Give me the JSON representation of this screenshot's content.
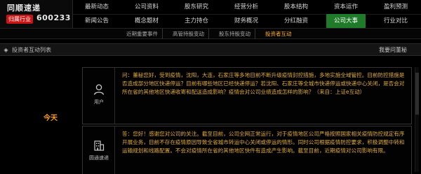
{
  "brand": {
    "title": "同顺速递",
    "badge": "归属行业",
    "stock_code": "600233"
  },
  "nav": {
    "row1": [
      "最新动态",
      "公司资料",
      "股东研究",
      "经营分析",
      "股本结构",
      "资本运作",
      "盈利预测"
    ],
    "row2": [
      "新闻公告",
      "概念题材",
      "主力持仓",
      "财务概况",
      "分红融资",
      "公司大事",
      "行业对比"
    ],
    "active": "公司大事"
  },
  "subnav": {
    "items": [
      "近期重要事件",
      "高管持股变动",
      "股东持股变动",
      "投资者互动"
    ],
    "active": "投资者互动"
  },
  "section": {
    "title": "投资者互动列表",
    "ask_button": "我要问董秘"
  },
  "date_label": "今天",
  "question": {
    "avatar_label": "用户",
    "prefix": "问：",
    "text": "董秘您好，受到疫情，沈阳，大连，石家庄等多地目前不断升级疫情封控措施，多地实施全域管控。目前防控措施是否造成部分地区快递停运？目前有哪些地区已经快递停运？若沈阳、石家庄等全城市快递停运或快递中心关闭，是否会对所在省的其他地区快递收寄和配送造成影响？疫情会对公司业绩造成怎样的影响？（来自：上证e互动）"
  },
  "answer": {
    "avatar_label": "圆通速递",
    "prefix": "答：",
    "text": "您好！感谢您对公司的关注。截至目前，公司全网正常运行，对于疫情地区公司严格按照国家相关疫情防控规定有序开展业务，目前不存在疫情原因导致全省城市转运中心关闭或停运的情形。同时公司根据疫情防控要求，积极调整中转和运输规划和线路配置。不会对疫情所在省的其他地区快件有造成产生影响。截至目前，近期疫情对公司影响有限。"
  }
}
